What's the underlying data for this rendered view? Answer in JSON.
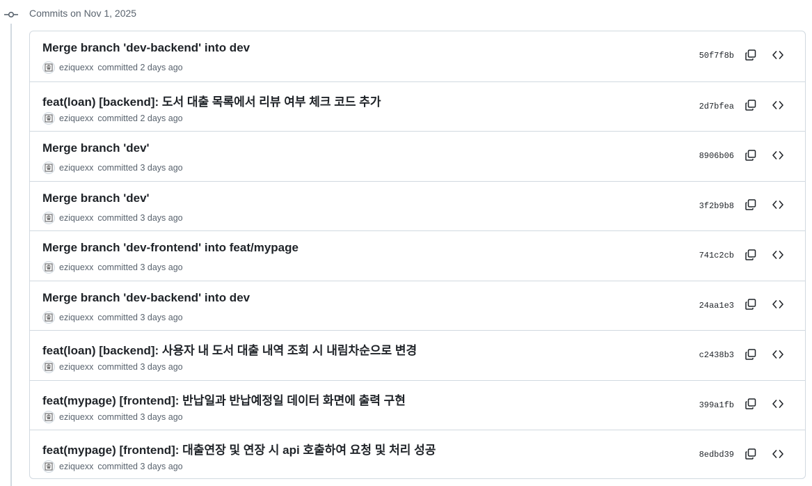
{
  "group": {
    "title": "Commits on Nov 1, 2025"
  },
  "commits": [
    {
      "title": "Merge branch 'dev-backend' into dev",
      "author": "eziquexx",
      "committed": "committed 2 days ago",
      "sha": "50f7f8b"
    },
    {
      "title": "feat(loan) [backend]: 도서 대출 목록에서 리뷰 여부 체크 코드 추가",
      "author": "eziquexx",
      "committed": "committed 2 days ago",
      "sha": "2d7bfea"
    },
    {
      "title": "Merge branch 'dev'",
      "author": "eziquexx",
      "committed": "committed 3 days ago",
      "sha": "8906b06"
    },
    {
      "title": "Merge branch 'dev'",
      "author": "eziquexx",
      "committed": "committed 3 days ago",
      "sha": "3f2b9b8"
    },
    {
      "title": "Merge branch 'dev-frontend' into feat/mypage",
      "author": "eziquexx",
      "committed": "committed 3 days ago",
      "sha": "741c2cb"
    },
    {
      "title": "Merge branch 'dev-backend' into dev",
      "author": "eziquexx",
      "committed": "committed 3 days ago",
      "sha": "24aa1e3"
    },
    {
      "title": "feat(loan) [backend]: 사용자 내 도서 대출 내역 조회 시 내림차순으로 변경",
      "author": "eziquexx",
      "committed": "committed 3 days ago",
      "sha": "c2438b3"
    },
    {
      "title": "feat(mypage) [frontend]: 반납일과 반납예정일 데이터 화면에 출력 구현",
      "author": "eziquexx",
      "committed": "committed 3 days ago",
      "sha": "399a1fb"
    },
    {
      "title": "feat(mypage) [frontend]: 대출연장 및 연장 시 api 호출하여 요청 및 처리 성공",
      "author": "eziquexx",
      "committed": "committed 3 days ago",
      "sha": "8edbd39"
    }
  ],
  "icons": {
    "group": "git-commit-icon",
    "copy": "copy-icon",
    "browse": "code-icon",
    "avatar": "avatar"
  },
  "colors": {
    "border": "#d1d9e0",
    "muted_text": "#59636e",
    "text": "#1f2328"
  }
}
